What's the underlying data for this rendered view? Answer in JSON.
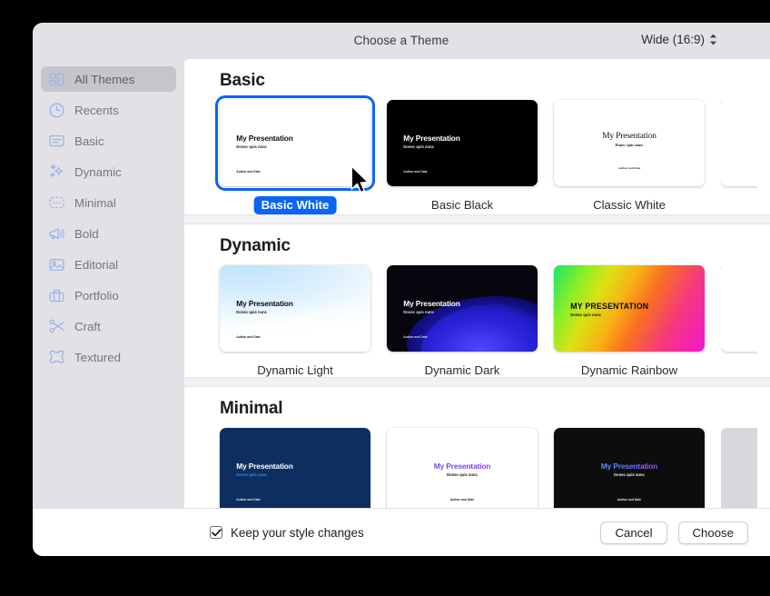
{
  "window": {
    "title": "Choose a Theme",
    "aspect_ratio": "Wide (16:9)"
  },
  "sidebar": {
    "items": [
      {
        "label": "All Themes",
        "icon": "grid-icon",
        "active": true
      },
      {
        "label": "Recents",
        "icon": "clock-icon",
        "active": false
      },
      {
        "label": "Basic",
        "icon": "card-icon",
        "active": false
      },
      {
        "label": "Dynamic",
        "icon": "sparkles-icon",
        "active": false
      },
      {
        "label": "Minimal",
        "icon": "dots-card-icon",
        "active": false
      },
      {
        "label": "Bold",
        "icon": "megaphone-icon",
        "active": false
      },
      {
        "label": "Editorial",
        "icon": "photo-icon",
        "active": false
      },
      {
        "label": "Portfolio",
        "icon": "briefcase-icon",
        "active": false
      },
      {
        "label": "Craft",
        "icon": "scissors-icon",
        "active": false
      },
      {
        "label": "Textured",
        "icon": "texture-frame-icon",
        "active": false
      }
    ]
  },
  "slide_text": {
    "title": "My Presentation",
    "title_upper": "MY PRESENTATION",
    "subtitle": "Donec quis nunc",
    "footer": "Author and Date"
  },
  "sections": [
    {
      "title": "Basic",
      "themes": [
        {
          "label": "Basic White",
          "selected": true
        },
        {
          "label": "Basic Black",
          "selected": false
        },
        {
          "label": "Classic White",
          "selected": false
        }
      ]
    },
    {
      "title": "Dynamic",
      "themes": [
        {
          "label": "Dynamic Light",
          "selected": false
        },
        {
          "label": "Dynamic Dark",
          "selected": false
        },
        {
          "label": "Dynamic Rainbow",
          "selected": false
        }
      ]
    },
    {
      "title": "Minimal",
      "themes": [
        {
          "label": "",
          "selected": false
        },
        {
          "label": "",
          "selected": false
        },
        {
          "label": "",
          "selected": false
        }
      ]
    }
  ],
  "footer": {
    "keep_changes_label": "Keep your style changes",
    "keep_changes_checked": true,
    "cancel_label": "Cancel",
    "choose_label": "Choose"
  },
  "colors": {
    "accent": "#0a65f5",
    "window_chrome": "#e3e1e6",
    "sidebar_selected": "#c6c5cb",
    "icon_blue": "#97b5e8",
    "content_bg": "#ffffff"
  }
}
